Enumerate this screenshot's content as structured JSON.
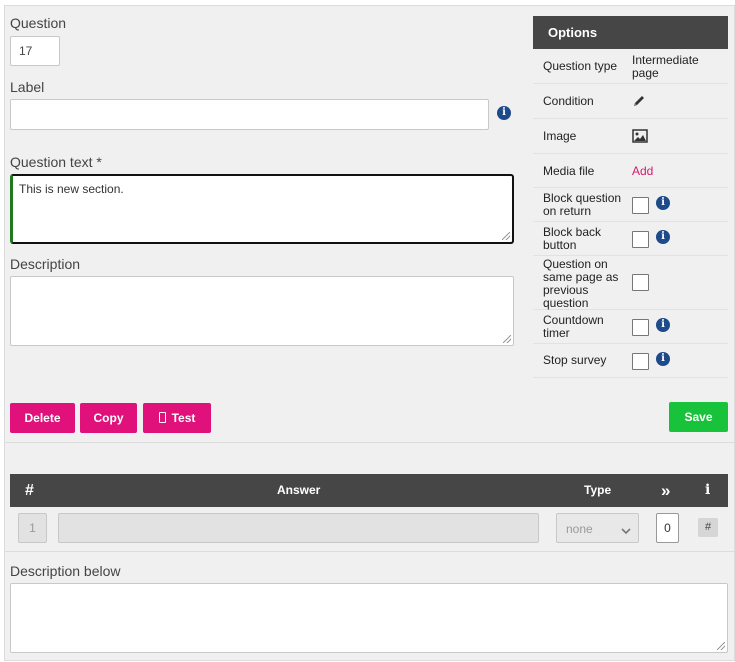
{
  "question": {
    "label": "Question",
    "number": "17"
  },
  "label_field": {
    "label": "Label",
    "value": ""
  },
  "question_text": {
    "label": "Question text *",
    "value": "This is new section."
  },
  "description": {
    "label": "Description",
    "value": ""
  },
  "description_below": {
    "label": "Description below",
    "value": ""
  },
  "options": {
    "title": "Options",
    "question_type": {
      "name": "Question type",
      "value": "Intermediate page"
    },
    "condition": {
      "name": "Condition",
      "icon": "pencil-icon"
    },
    "image": {
      "name": "Image",
      "icon": "image-icon"
    },
    "media_file": {
      "name": "Media file",
      "action": "Add"
    },
    "block_question_on_return": {
      "name": "Block question on return",
      "checked": false
    },
    "block_back_button": {
      "name": "Block back button",
      "checked": false
    },
    "same_page": {
      "name": "Question on same page as previous question",
      "checked": false
    },
    "countdown_timer": {
      "name": "Countdown timer",
      "checked": false
    },
    "stop_survey": {
      "name": "Stop survey",
      "checked": false
    }
  },
  "buttons": {
    "delete": "Delete",
    "copy": "Copy",
    "test": "Test",
    "save": "Save"
  },
  "colors": {
    "primary_button": "#e0117a",
    "save_button": "#18c23a",
    "header_dark": "#464646"
  },
  "answers": {
    "headers": {
      "number": "#",
      "answer": "Answer",
      "type": "Type",
      "jump": "»",
      "info": "i"
    },
    "rows": [
      {
        "number": "1",
        "text": "",
        "type": "none",
        "jump": "0",
        "hash": "#"
      }
    ]
  }
}
